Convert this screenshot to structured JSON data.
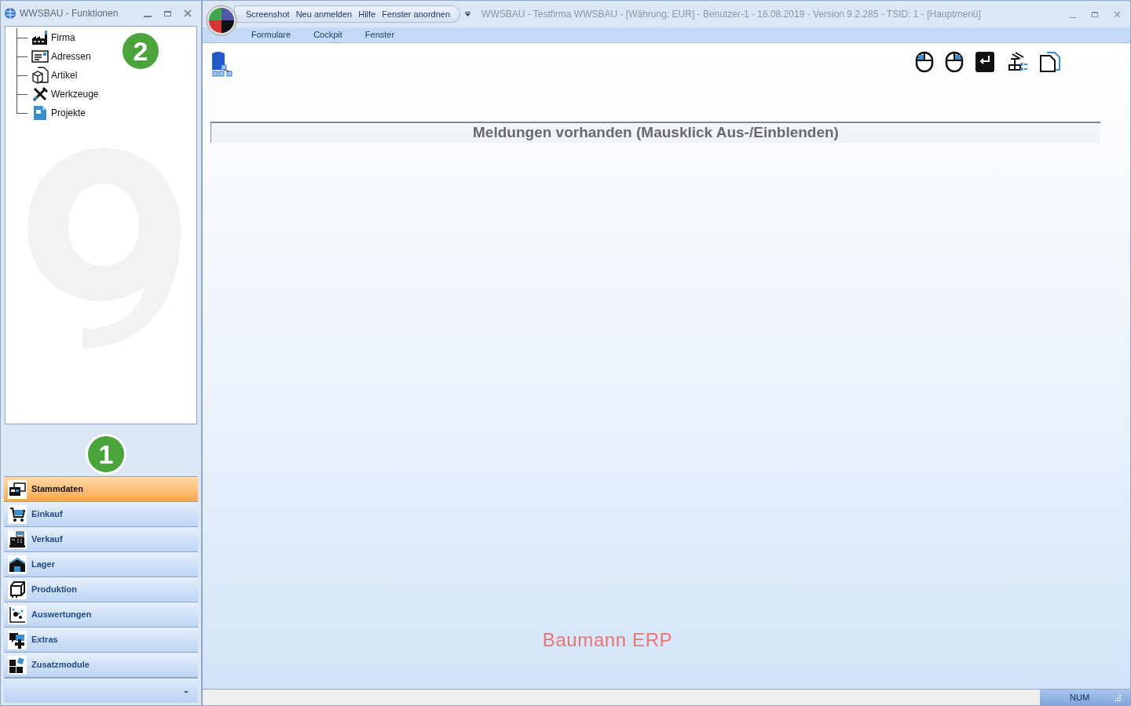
{
  "side_window": {
    "title": "WWSBAU - Funktionen"
  },
  "tree": [
    {
      "label": "Firma"
    },
    {
      "label": "Adressen"
    },
    {
      "label": "Artikel"
    },
    {
      "label": "Werkzeuge"
    },
    {
      "label": "Projekte"
    }
  ],
  "nav": [
    {
      "label": "Stammdaten",
      "selected": true
    },
    {
      "label": "Einkauf",
      "selected": false
    },
    {
      "label": "Verkauf",
      "selected": false
    },
    {
      "label": "Lager",
      "selected": false
    },
    {
      "label": "Produktion",
      "selected": false
    },
    {
      "label": "Auswertungen",
      "selected": false
    },
    {
      "label": "Extras",
      "selected": false
    },
    {
      "label": "Zusatzmodule",
      "selected": false
    }
  ],
  "callouts": [
    "2",
    "1"
  ],
  "main_window": {
    "title": "WWSBAU - Testfirma WWSBAU - [Währung: EUR] - Benutzer-1 - 16.08.2019 - Version 9.2.285 - TSID: 1  - [Hauptmenü]"
  },
  "quick_access": [
    "Screenshot",
    "Neu anmelden",
    "Hilfe",
    "Fenster anordnen"
  ],
  "menu": [
    "Formulare",
    "Cockpit",
    "Fenster"
  ],
  "messages_bar": "Meldungen vorhanden  (Mausklick Aus-/Einblenden)",
  "brand": "Baumann ERP",
  "status_bar": {
    "indicator": "NUM"
  }
}
